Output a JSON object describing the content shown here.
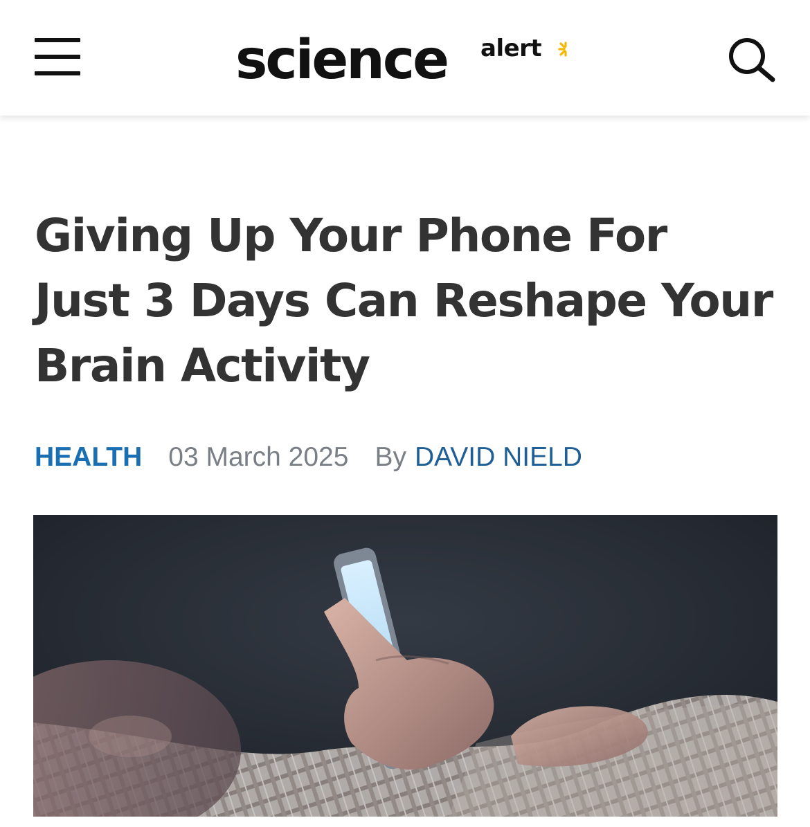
{
  "header": {
    "menu_icon": "hamburger-menu-icon",
    "logo_main": "science",
    "logo_sub": "alert",
    "logo_accent_color": "#f5b800",
    "search_icon": "search-icon"
  },
  "article": {
    "title": "Giving Up Your Phone For Just 3 Days Can Reshape Your Brain Activity",
    "category": "HEALTH",
    "date": "03 March 2025",
    "byline_prefix": "By",
    "author": "DAVID NIELD",
    "category_color": "#1a6fb3",
    "author_color": "#1f5f96"
  },
  "hero_image": {
    "subject": "hand-holding-glowing-smartphone-in-bed-photo"
  }
}
